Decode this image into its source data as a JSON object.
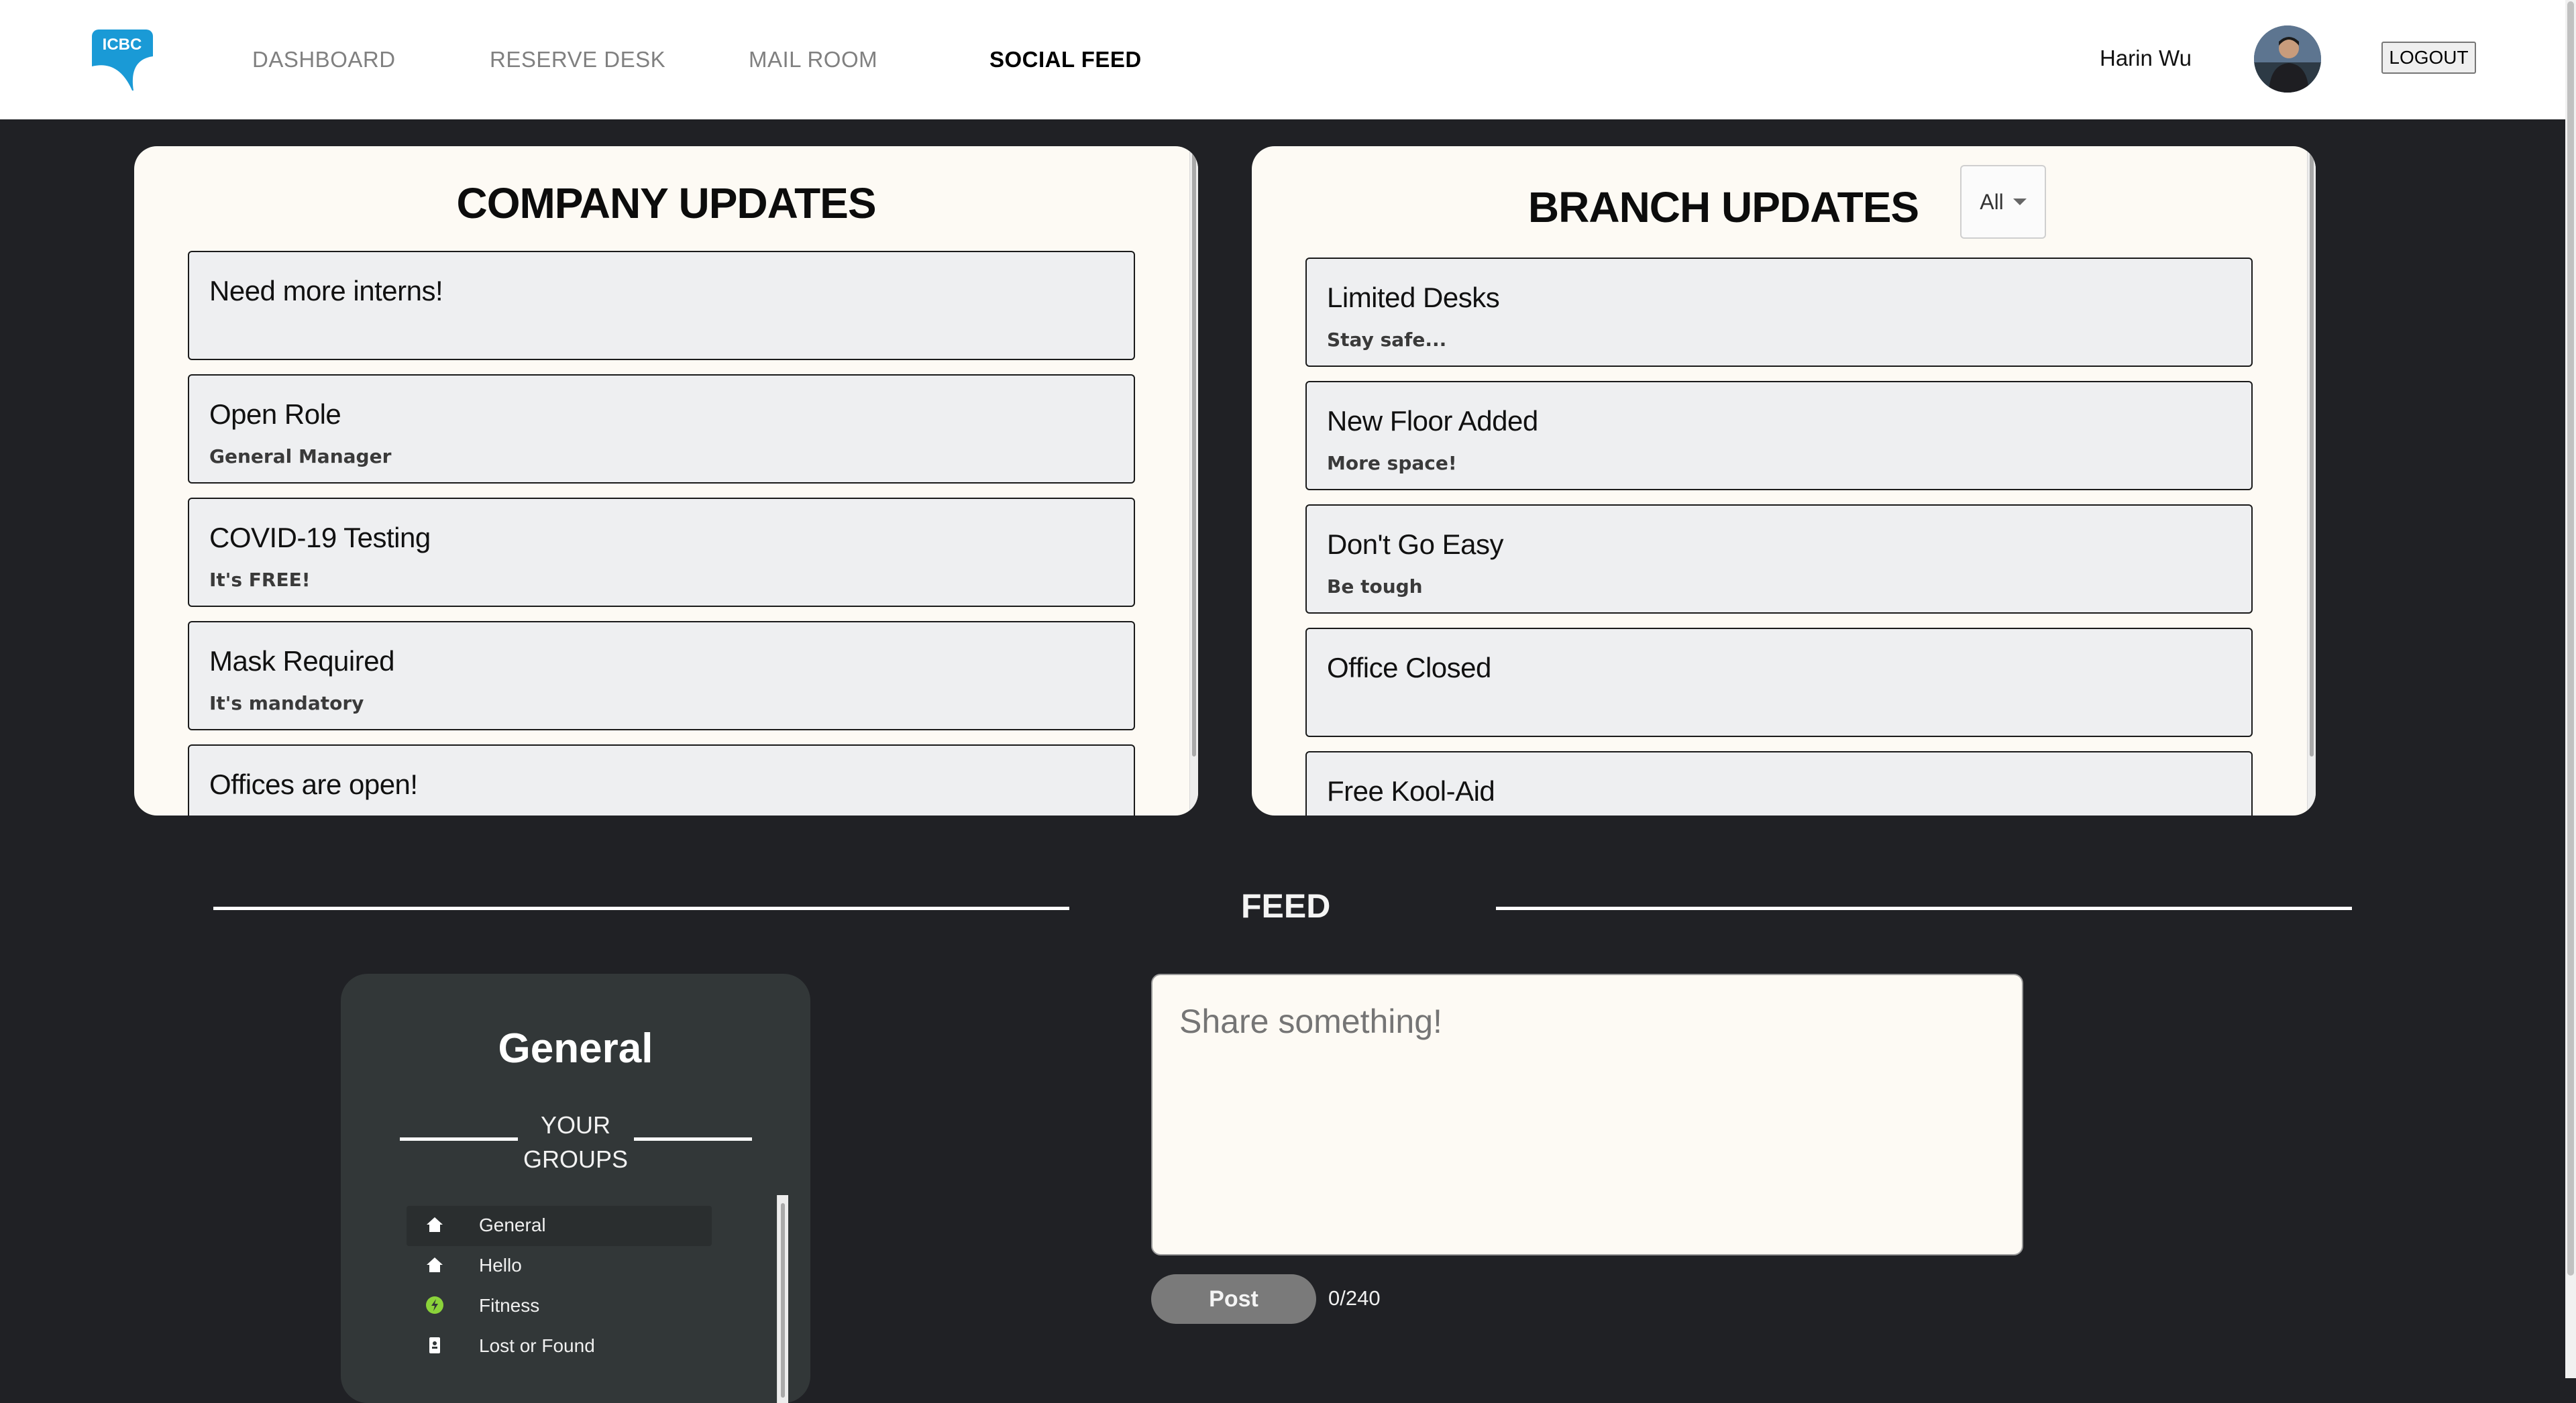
{
  "nav": {
    "logo_text": "ICBC",
    "links": [
      "DASHBOARD",
      "RESERVE DESK",
      "MAIL ROOM",
      "SOCIAL FEED"
    ],
    "active": "SOCIAL FEED",
    "user_name": "Harin Wu",
    "logout_label": "LOGOUT"
  },
  "company_updates": {
    "title": "COMPANY UPDATES",
    "items": [
      {
        "title": "Need more interns!",
        "subtitle": ""
      },
      {
        "title": "Open Role",
        "subtitle": "General Manager"
      },
      {
        "title": "COVID-19 Testing",
        "subtitle": "It's FREE!"
      },
      {
        "title": "Mask Required",
        "subtitle": "It's mandatory"
      },
      {
        "title": "Offices are open!",
        "subtitle": ""
      }
    ]
  },
  "branch_updates": {
    "title": "BRANCH UPDATES",
    "filter_value": "All",
    "items": [
      {
        "title": "Limited Desks",
        "subtitle": "Stay safe..."
      },
      {
        "title": "New Floor Added",
        "subtitle": "More space!"
      },
      {
        "title": "Don't Go Easy",
        "subtitle": "Be tough"
      },
      {
        "title": "Office Closed",
        "subtitle": ""
      },
      {
        "title": "Free Kool-Aid",
        "subtitle": ""
      }
    ]
  },
  "feed": {
    "title": "FEED",
    "current_group": "General",
    "your_groups_label": "YOUR GROUPS",
    "groups": [
      {
        "label": "General",
        "icon": "home-icon",
        "selected": true
      },
      {
        "label": "Hello",
        "icon": "home-icon",
        "selected": false
      },
      {
        "label": "Fitness",
        "icon": "fitness-icon",
        "selected": false
      },
      {
        "label": "Lost or Found",
        "icon": "lost-found-icon",
        "selected": false
      }
    ],
    "share_placeholder": "Share something!",
    "post_label": "Post",
    "char_count": "0/240"
  },
  "colors": {
    "background": "#202125",
    "panel": "#fdfaf4",
    "card": "#eeeff1",
    "groups_panel": "#323738",
    "logo_blue": "#1a9ad6",
    "fitness_green": "#8bd33a"
  }
}
